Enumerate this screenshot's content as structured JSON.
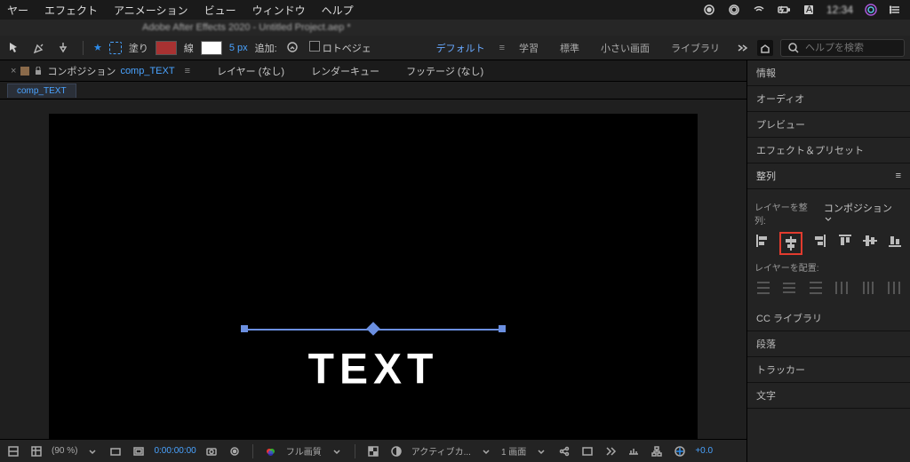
{
  "menubar": {
    "items": [
      "ヤー",
      "エフェクト",
      "アニメーション",
      "ビュー",
      "ウィンドウ",
      "ヘルプ"
    ],
    "clock": "12:34"
  },
  "titlebar": {
    "text": "Adobe After Effects 2020 - Untitled Project.aep *"
  },
  "options": {
    "star": "★",
    "fill_label": "塗り",
    "stroke_label": "線",
    "stroke_px": "5 px",
    "add_label": "追加:",
    "roto_label": "ロトベジェ",
    "workspaces": [
      "デフォルト",
      "学習",
      "標準",
      "小さい画面",
      "ライブラリ"
    ],
    "search_placeholder": "ヘルプを検索"
  },
  "panels": {
    "comp_prefix": "コンポジション",
    "comp_name": "comp_TEXT",
    "menu_glyph": "≡",
    "layer_tab": "レイヤー (なし)",
    "render_tab": "レンダーキュー",
    "footage_tab": "フッテージ (なし)",
    "subtab": "comp_TEXT"
  },
  "canvas_text": "TEXT",
  "footer": {
    "zoom": "(90 %)",
    "time": "0:00:00:00",
    "res": "フル画質",
    "camera": "アクティブカ...",
    "views": "1 画面",
    "exposure": "+0.0"
  },
  "sidebar": {
    "info": "情報",
    "audio": "オーディオ",
    "preview": "プレビュー",
    "effects": "エフェクト＆プリセット",
    "align_title": "整列",
    "align_to_label": "レイヤーを整列:",
    "align_to_value": "コンポジション",
    "distribute_label": "レイヤーを配置:",
    "cc": "CC ライブラリ",
    "paragraph": "段落",
    "tracker": "トラッカー",
    "character": "文字"
  }
}
